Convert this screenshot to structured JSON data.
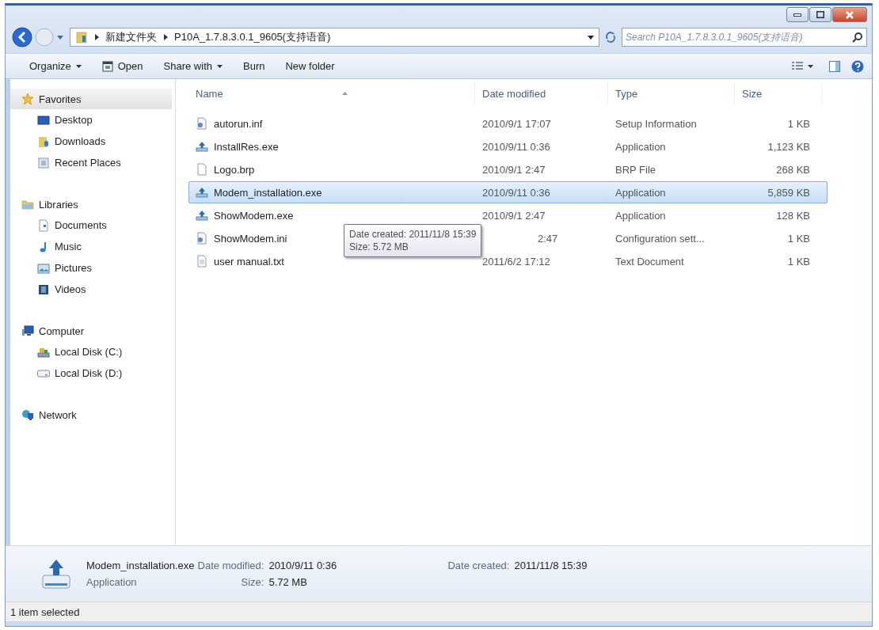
{
  "address": {
    "path": [
      "新建文件夹",
      "P10A_1.7.8.3.0.1_9605(支持语音)"
    ]
  },
  "search": {
    "placeholder": "Search P10A_1.7.8.3.0.1_9605(支持语音)"
  },
  "toolbar": [
    {
      "label": "Organize",
      "kind": "menu"
    },
    {
      "label": "Open",
      "kind": "icon-button"
    },
    {
      "label": "Share with",
      "kind": "menu"
    },
    {
      "label": "Burn",
      "kind": "button"
    },
    {
      "label": "New folder",
      "kind": "button"
    }
  ],
  "sidebar": [
    {
      "label": "Favorites",
      "selected": true,
      "items": [
        {
          "label": "Desktop",
          "selected": false
        },
        {
          "label": "Downloads",
          "selected": false
        },
        {
          "label": "Recent Places",
          "selected": false
        }
      ]
    },
    {
      "label": "Libraries",
      "selected": false,
      "items": [
        {
          "label": "Documents",
          "selected": false
        },
        {
          "label": "Music",
          "selected": false
        },
        {
          "label": "Pictures",
          "selected": false
        },
        {
          "label": "Videos",
          "selected": false
        }
      ]
    },
    {
      "label": "Computer",
      "selected": false,
      "items": [
        {
          "label": "Local Disk (C:)",
          "selected": false
        },
        {
          "label": "Local Disk (D:)",
          "selected": false
        }
      ]
    },
    {
      "label": "Network",
      "selected": false
    }
  ],
  "table": {
    "columns": [
      "Name",
      "Date modified",
      "Type",
      "Size"
    ],
    "rows": [
      {
        "name": "autorun.inf",
        "date": "2010/9/1 17:07",
        "type": "Setup Information",
        "size": "1 KB",
        "selected": false
      },
      {
        "name": "InstallRes.exe",
        "date": "2010/9/11 0:36",
        "type": "Application",
        "size": "1,123 KB",
        "selected": false
      },
      {
        "name": "Logo.brp",
        "date": "2010/9/1 2:47",
        "type": "BRP File",
        "size": "268 KB",
        "selected": false
      },
      {
        "name": "Modem_installation.exe",
        "date": "2010/9/11 0:36",
        "type": "Application",
        "size": "5,859 KB",
        "selected": true
      },
      {
        "name": "ShowModem.exe",
        "date": "2010/9/1 2:47",
        "type": "Application",
        "size": "128 KB",
        "selected": false
      },
      {
        "name": "ShowModem.ini",
        "date": "2:47",
        "type": "Configuration sett...",
        "size": "1 KB",
        "selected": false,
        "covered": true
      },
      {
        "name": "user manual.txt",
        "date": "2011/6/2 17:12",
        "type": "Text Document",
        "size": "1 KB",
        "selected": false
      }
    ]
  },
  "tooltip": {
    "lines": [
      "Date created: 2011/11/8 15:39",
      "Size: 5.72 MB"
    ]
  },
  "details": {
    "name": "Modem_installation.exe",
    "type": "Application",
    "fields": [
      {
        "label": "Date modified:",
        "value": "2010/9/11 0:36"
      },
      {
        "label": "Size:",
        "value": "5.72 MB"
      },
      {
        "label": "Date created:",
        "value": "2011/11/8 15:39"
      }
    ]
  },
  "status_bar": {
    "text": "1 item selected"
  }
}
